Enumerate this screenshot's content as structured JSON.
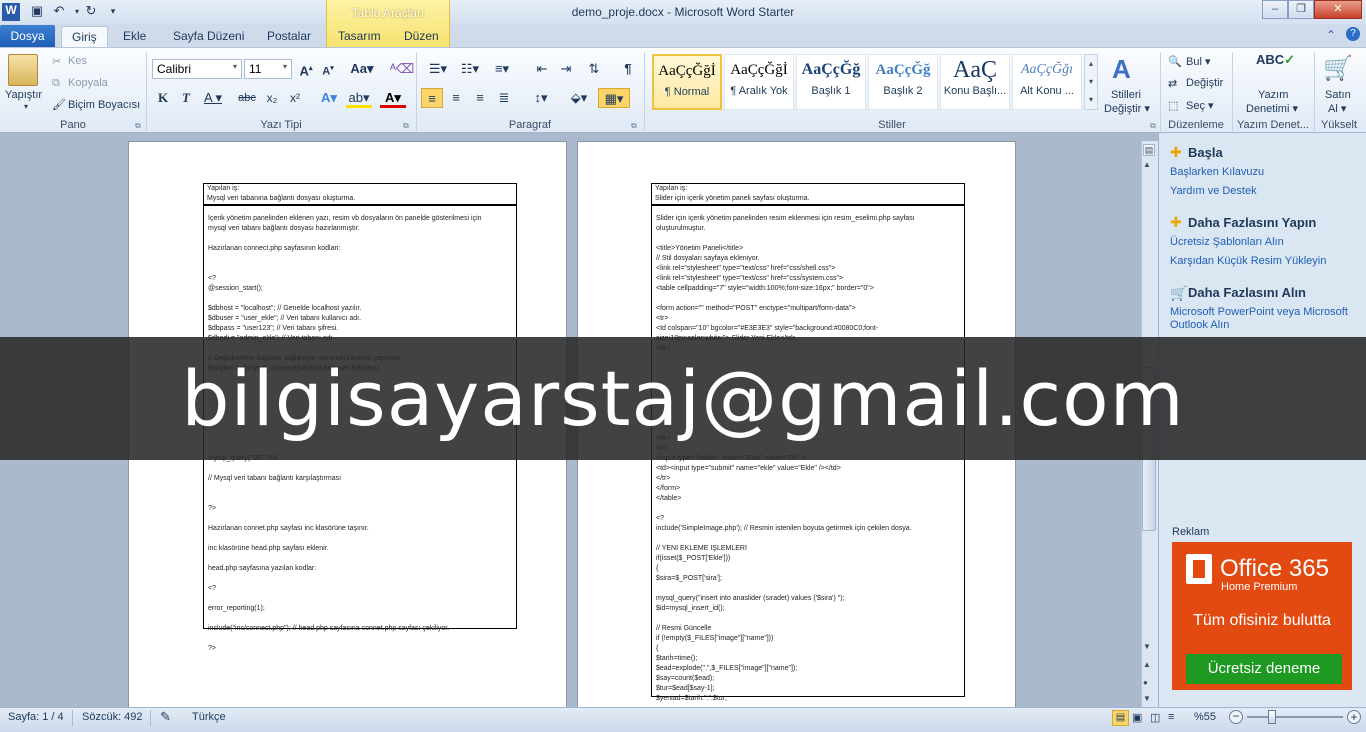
{
  "window": {
    "title": "demo_proje.docx  -  Microsoft Word Starter",
    "context_tab": "Tablo Araçları"
  },
  "tabs": [
    "Dosya",
    "Giriş",
    "Ekle",
    "Sayfa Düzeni",
    "Postalar",
    "Tasarım",
    "Düzen"
  ],
  "ribbon": {
    "clipboard": {
      "paste": "Yapıştır",
      "cut": "Kes",
      "copy": "Kopyala",
      "format_painter": "Biçim Boyacısı",
      "label": "Pano"
    },
    "font": {
      "name": "Calibri",
      "size": "11",
      "label": "Yazı Tipi"
    },
    "paragraph": {
      "label": "Paragraf"
    },
    "styles": {
      "items": [
        {
          "preview": "AaÇçĞğİ",
          "name": "¶ Normal"
        },
        {
          "preview": "AaÇçĞğİ",
          "name": "¶ Aralık Yok"
        },
        {
          "preview": "AaÇçĞğ",
          "name": "Başlık 1"
        },
        {
          "preview": "AaÇçĞğ",
          "name": "Başlık 2"
        },
        {
          "preview": "AaÇ",
          "name": "Konu Başlı..."
        },
        {
          "preview": "AaÇçĞğı",
          "name": "Alt Konu ..."
        }
      ],
      "change_line1": "Stilleri",
      "change_line2": "Değiştir ▾",
      "label": "Stiller"
    },
    "editing": {
      "find": "Bul ▾",
      "replace": "Değiştir",
      "select": "Seç ▾",
      "label": "Düzenleme"
    },
    "proofing": {
      "line1": "Yazım",
      "line2": "Denetimi ▾",
      "label": "Yazım Denet..."
    },
    "upgrade": {
      "line1": "Satın",
      "line2": "Al ▾",
      "label": "Yükselt"
    }
  },
  "page1": {
    "header_line1": "Yapılan iş:",
    "header_line2": "Mysql veri tabanına bağlantı dosyası oluşturma.",
    "lines": [
      "İçerik yönetim panelinden eklenen yazı, resim vb dosyaların ön panelde gösterilmesi için",
      "mysql veri tabanı bağlantı dosyası hazırlanmıştır.",
      "",
      "Hazırlanan  connect.php  sayfasının kodları:",
      "",
      "",
      "<?",
      "@session_start();",
      "",
      "$dbhost                    = \"localhost\";       // Genelde localhost yazılır.",
      "$dbuser                    = \"user_ekle\";       // Veri tabanı kullanıcı adı.",
      "$dbpass                    = \"user123\";         // Veri tabanı şifresi.",
      "$dbadi             = \"admin_ekle\";   //  Veri tabanı adı.",
      "",
      "// Değişkenlere bağlantı sağlanıyor mu onun kontrolü yapılıyor.",
      "$baglan = @mysql_connect($dbhost,$dbuser,$dbpass)",
      "",
      "",
      "",
      "",
      "",
      "",
      "",
      "",
      "mysql_query(\"SET NA",
      "",
      "// Mysql veri tabanı bağlantı karşılaştırması",
      "",
      "",
      "?>",
      "",
      "Hazırlanan connet.php sayfası inc klasörüne taşınır.",
      "",
      "inc klasörüne head.php sayfası eklenir.",
      "",
      "head.php sayfasına yazılan kodlar:",
      "",
      "<?",
      "",
      "error_reporting(1);",
      "",
      "include(\"inc/connect.php\");          // head.php sayfasına connet.php  sayfası çekiliyor.",
      "",
      "?>"
    ]
  },
  "page2": {
    "header_line1": "Yapılan iş:",
    "header_line2": "Slider için içerik yönetim paneli sayfası oluşturma.",
    "lines": [
      "Slider için içerik yönetim panelinden resim eklenmesi için resim_eselimi.php sayfası",
      "oluşturulmuştur.",
      "",
      "<title>Yönetim Paneli</title>",
      "// Stil dosyaları sayfaya ekleniyor.",
      "<link rel=\"stylesheet\" type=\"text/css\" href=\"css/shell.css\">",
      "<link rel=\"stylesheet\" type=\"text/css\" href=\"css/system.css\">",
      "<table cellpadding=\"7\" style=\"width:100%;font-size:16px;\" border=\"0\">",
      "",
      "    <form action=\"\" method=\"POST\" enctype=\"multipart/form-data\">",
      "            <tr>",
      "            <td colspan=\"10\" bgcolor=\"#E3E3E3\" style=\"background:#0080C0;font-",
      "size:18px;color:white;\"> Slider  Yeni Ekle</td>",
      "</tr>",
      "",
      "",
      "",
      "",
      "",
      "",
      "",
      "",
      "      </tr>",
      "     <tr>",
      "                      <input type=\"hidden\" name=\"Ekle\" value=\"Ok\" />",
      "                      <td><input type=\"submit\" name=\"ekle\" value=\"Ekle\" /></td>",
      "            </tr>",
      "    </form>",
      "</table>",
      "",
      "<?",
      "include('SimpleImage.php');     // Resmin istenilen boyuta getirmek için çekilen dosya.",
      "",
      "// YENİ EKLEME İŞLEMLERİ",
      "if(isset($_POST['Ekle']))",
      "{",
      "                      $sira=$_POST['sira'];",
      "",
      "mysql_query(\"insert into anaslider (sıradet) values ('$sira') \");",
      "         $id=mysql_insert_id();",
      "",
      "           // Resmi Güncelle",
      "                                   if (!empty($_FILES[\"image\"][\"name\"]))",
      "                                   {",
      "                                                     $tarih=time();",
      "                                                     $ead=explode(\".\",$_FILES[\"image\"][\"name\"]);",
      "                                                     $say=count($ead);",
      "                                                     $tur=$ead[$say-1];",
      "                                                     $yeniad=$tarih.\".\".$tur;"
    ]
  },
  "pane": {
    "section1": {
      "title": "Başla",
      "links": [
        "Başlarken Kılavuzu",
        "Yardım ve Destek"
      ]
    },
    "section2": {
      "title": "Daha Fazlasını Yapın",
      "links": [
        "Ücretsiz Şablonları Alın",
        "Karşıdan Küçük Resim Yükleyin"
      ]
    },
    "section3": {
      "title": "Daha Fazlasını Alın",
      "links": [
        "Microsoft PowerPoint veya Microsoft Outlook Alın"
      ]
    },
    "ad_label": "Reklam",
    "ad": {
      "title": "Office 365",
      "subtitle": "Home Premium",
      "tagline": "Tüm ofisiniz bulutta",
      "cta": "Ücretsiz deneme"
    }
  },
  "banner": {
    "text": "bilgisayarstaj@gmail.com"
  },
  "status": {
    "page": "Sayfa: 1 / 4",
    "words": "Sözcük: 492",
    "language": "Türkçe",
    "zoom": "%55"
  }
}
